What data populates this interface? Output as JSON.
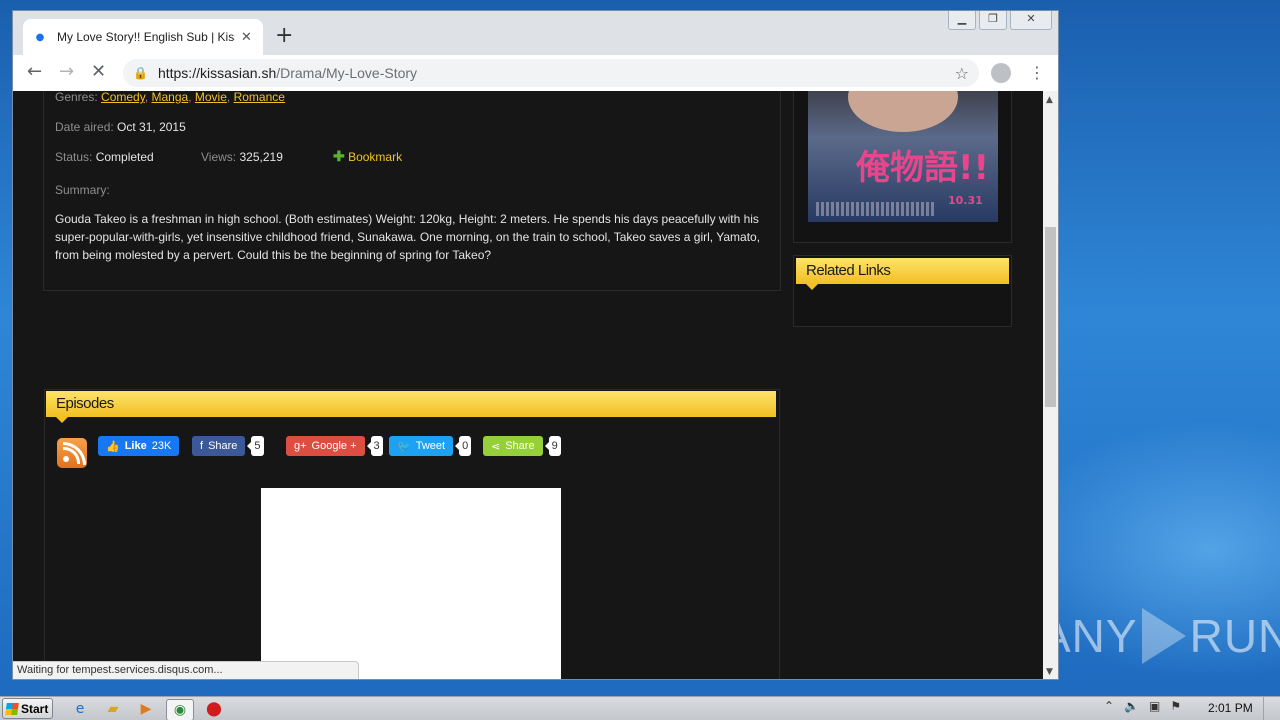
{
  "browser": {
    "tab_title": "My Love Story!! English Sub | KissAs",
    "tab_close": "✕",
    "new_tab": "+",
    "url_host": "https://kissasian.sh",
    "url_path": "/Drama/My-Love-Story",
    "status_text": "Waiting for tempest.services.disqus.com..."
  },
  "details": {
    "genres_label": "Genres:",
    "genres": [
      "Comedy",
      "Manga",
      "Movie",
      "Romance"
    ],
    "date_label": "Date aired:",
    "date_value": "Oct 31, 2015",
    "status_label": "Status:",
    "status_value": "Completed",
    "views_label": "Views:",
    "views_value": "325,219",
    "bookmark_label": "Bookmark",
    "summary_label": "Summary:",
    "summary_text": "Gouda Takeo is a freshman in high school. (Both estimates) Weight: 120kg, Height: 2 meters. He spends his days peacefully with his super-popular-with-girls, yet insensitive childhood friend, Sunakawa. One morning, on the train to school, Takeo saves a girl, Yamato, from being molested by a pervert. Could this be the beginning of spring for Takeo?"
  },
  "poster": {
    "kanji": "俺物語!!",
    "date": "10.31"
  },
  "sidebar": {
    "related_links_title": "Related Links"
  },
  "episodes": {
    "title": "Episodes",
    "social": [
      {
        "label": "Like",
        "count_inline": "23K",
        "color": "#1877f2"
      },
      {
        "label": "Share",
        "count": "5",
        "color": "#3b5998"
      },
      {
        "label": "Google +",
        "count": "3",
        "color": "#dc4e41"
      },
      {
        "label": "Tweet",
        "count": "0",
        "color": "#1da1f2"
      },
      {
        "label": "Share",
        "count": "9",
        "color": "#95d03a"
      }
    ]
  },
  "taskbar": {
    "start_label": "Start",
    "clock": "2:01 PM"
  },
  "watermark": {
    "text": "ANY",
    "text2": "RUN"
  }
}
